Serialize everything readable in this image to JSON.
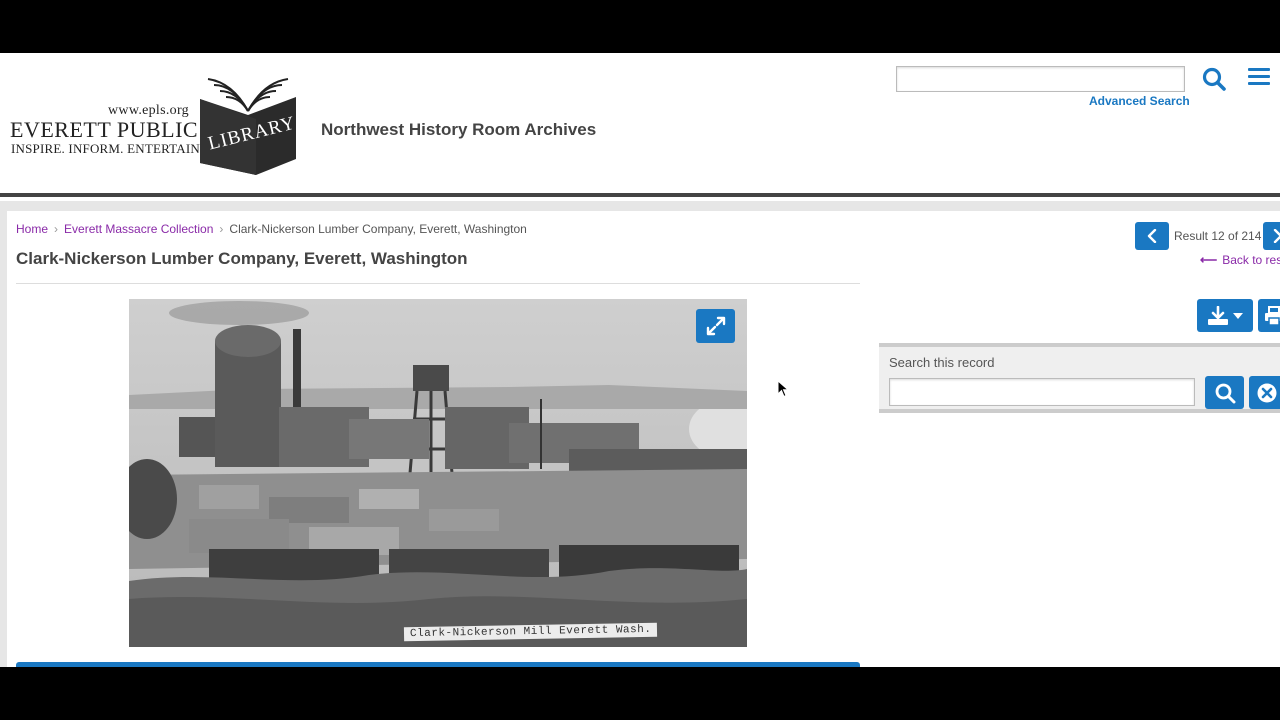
{
  "header": {
    "logo": {
      "url_text": "www.epls.org",
      "name_text": "EVERETT PUBLIC",
      "book_word": "LIBRARY",
      "tagline": "INSPIRE. INFORM. ENTERTAIN."
    },
    "site_title": "Northwest History Room Archives",
    "search": {
      "value": "",
      "placeholder": ""
    },
    "advanced_search_label": "Advanced Search",
    "search_icon": "search-icon",
    "menu_icon": "hamburger-menu-icon"
  },
  "breadcrumb": {
    "items": [
      {
        "label": "Home"
      },
      {
        "label": "Everett Massacre Collection"
      },
      {
        "label": "Clark-Nickerson Lumber Company, Everett, Washington"
      }
    ],
    "separator": "›"
  },
  "record": {
    "title": "Clark-Nickerson Lumber Company, Everett, Washington",
    "photo_caption": "Clark-Nickerson Mill   Everett Wash.",
    "expand_icon": "expand-icon"
  },
  "pager": {
    "text": "Result 12 of 214",
    "back_label": "Back to resu",
    "prev_icon": "chevron-left-icon",
    "next_icon": "chevron-right-icon"
  },
  "actions": {
    "download_icon": "download-icon",
    "print_icon": "print-icon"
  },
  "search_record": {
    "label": "Search this record",
    "value": "",
    "search_icon": "search-icon",
    "clear_icon": "clear-icon"
  },
  "colors": {
    "accent": "#1a78c2",
    "link_visited": "#8a2aa8",
    "title_text": "#444444"
  }
}
